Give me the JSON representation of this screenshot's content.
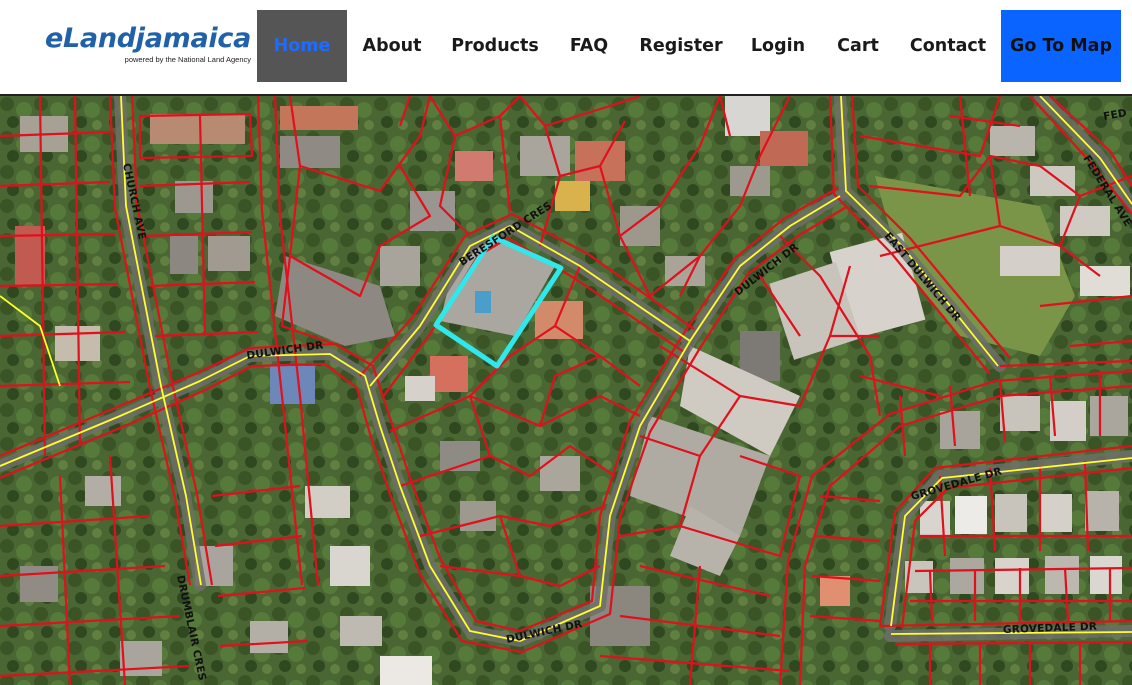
{
  "brand": {
    "name": "eLandjamaica",
    "tagline": "powered by the National Land Agency",
    "color": "#2161a8"
  },
  "nav": {
    "items": [
      {
        "label": "Home",
        "active": true
      },
      {
        "label": "About"
      },
      {
        "label": "Products"
      },
      {
        "label": "FAQ"
      },
      {
        "label": "Register"
      },
      {
        "label": "Login"
      },
      {
        "label": "Cart"
      },
      {
        "label": "Contact"
      }
    ],
    "cta_label": "Go To Map",
    "active_bg": "#555555",
    "active_text": "#1e6bff",
    "cta_bg": "#0a64ff"
  },
  "map": {
    "street_labels": {
      "beresford": "BERESFORD CRES",
      "dulwich_top": "DULWICH DR",
      "dulwich_left": "DULWICH DR",
      "dulwich_bottom": "DULWICH DR",
      "east_dulwich": "EAST DULWICH DR",
      "federal": "FEDERAL AVE",
      "federal_top": "FED",
      "grovedale_mid": "GROVEDALE DR",
      "grovedale_bottom": "GROVEDALE DR",
      "drumblair": "DRUMBLAIR CRES",
      "church": "CHURCH AVE"
    },
    "colors": {
      "parcel": "#e0101c",
      "road": "#ffff2a",
      "highlight": "#30e8ec"
    }
  }
}
